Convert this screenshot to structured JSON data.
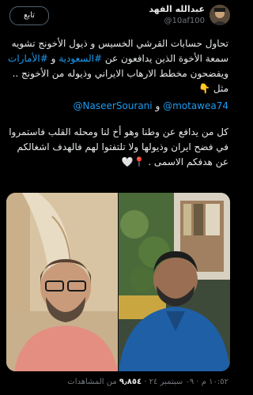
{
  "header": {
    "display_name": "عبدالله الفهد",
    "handle": "@10af100",
    "follow_label": "تابع"
  },
  "tweet": {
    "para1_a": "تحاول حسابات القرشي الخسيس و ذيول الأخونج تشويه سمعة الأخوة الذين يدافعون عن ",
    "hashtag_saudi": "#السعودية",
    "para1_b": " و ",
    "hashtag_uae": "#الأمارات",
    "para1_c": " ويفضحون مخطط الارهاب الايراني وذيوله من الأخونج .. مثل ",
    "emoji_point": "👇",
    "mention1": "@NaseerSourani",
    "mentions_sep": " و ",
    "mention2": "@motawea74",
    "para3": "كل من يدافع عن وطنا وهو أخ لنا ومحله القلب فاستمروا في فضح ايران وذيولها ولا تلتفتوا لهم فالهدف اشغالكم عن هدفكم الاسمى .",
    "emoji_end": "📍🤍"
  },
  "footer": {
    "time": "١٠:٥٢ م",
    "date": "٠٩ سبتمبر ٢٤",
    "sep": " · ",
    "views_count": "٩٫٨٥٤",
    "views_label": "من المشاهدات"
  }
}
